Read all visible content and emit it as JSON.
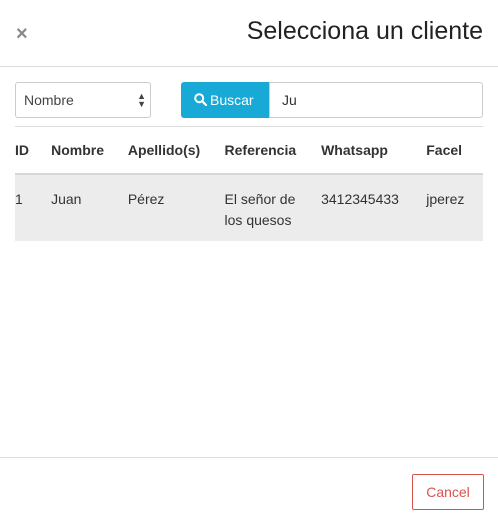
{
  "modal": {
    "title": "Selecciona un cliente",
    "close_symbol": "×",
    "close_icon": "close-icon"
  },
  "search": {
    "field_selected": "Nombre",
    "button_label": "Buscar",
    "button_icon": "search-icon",
    "query": "Ju"
  },
  "table": {
    "columns": [
      "ID",
      "Nombre",
      "Apellido(s)",
      "Referencia",
      "Whatsapp",
      "Facel"
    ],
    "rows": [
      {
        "id": "1",
        "nombre": "Juan",
        "apellidos": "Pérez",
        "referencia_line1": "El señor de",
        "referencia_line2": "los quesos",
        "whatsapp": "3412345433",
        "facebook": "jperez"
      }
    ]
  },
  "footer": {
    "cancel_label": "Cancel"
  },
  "colors": {
    "primary": "#18a9d6",
    "danger": "#d9534f",
    "row_highlight": "#ececec"
  }
}
